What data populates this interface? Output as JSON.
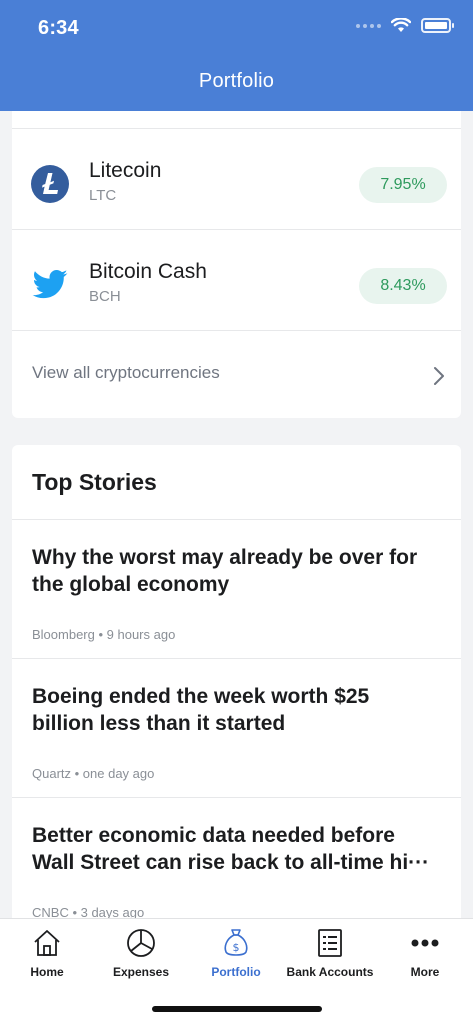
{
  "status_bar": {
    "time": "6:34"
  },
  "header": {
    "title": "Portfolio"
  },
  "crypto": {
    "items": [
      {
        "name": "Litecoin",
        "symbol": "LTC",
        "change": "7.95%",
        "icon": "litecoin-icon"
      },
      {
        "name": "Bitcoin Cash",
        "symbol": "BCH",
        "change": "8.43%",
        "icon": "twitter-bird-icon"
      }
    ],
    "view_all_label": "View all cryptocurrencies"
  },
  "stories": {
    "title": "Top Stories",
    "items": [
      {
        "headline_line1": "Why the worst may already be over for",
        "headline_line2": "the global economy",
        "meta": "Bloomberg • 9 hours ago"
      },
      {
        "headline_line1": "Boeing ended the week worth $25",
        "headline_line2": "billion less than it started",
        "meta": "Quartz • one day ago"
      },
      {
        "headline_line1": "Better economic data needed before",
        "headline_line2": "Wall Street can rise back to all-time hi···",
        "meta": "CNBC • 3 days ago"
      }
    ]
  },
  "tabbar": {
    "tabs": [
      {
        "label": "Home",
        "icon": "home-icon"
      },
      {
        "label": "Expenses",
        "icon": "pie-chart-icon"
      },
      {
        "label": "Portfolio",
        "icon": "money-bag-icon",
        "active": true
      },
      {
        "label": "Bank Accounts",
        "icon": "statement-icon"
      },
      {
        "label": "More",
        "icon": "more-dots-icon"
      }
    ]
  },
  "colors": {
    "accent": "#4a7fd6",
    "positive": "#2e9a5d",
    "positive_bg": "#e8f4ee",
    "active_tab": "#3b6fcf"
  }
}
